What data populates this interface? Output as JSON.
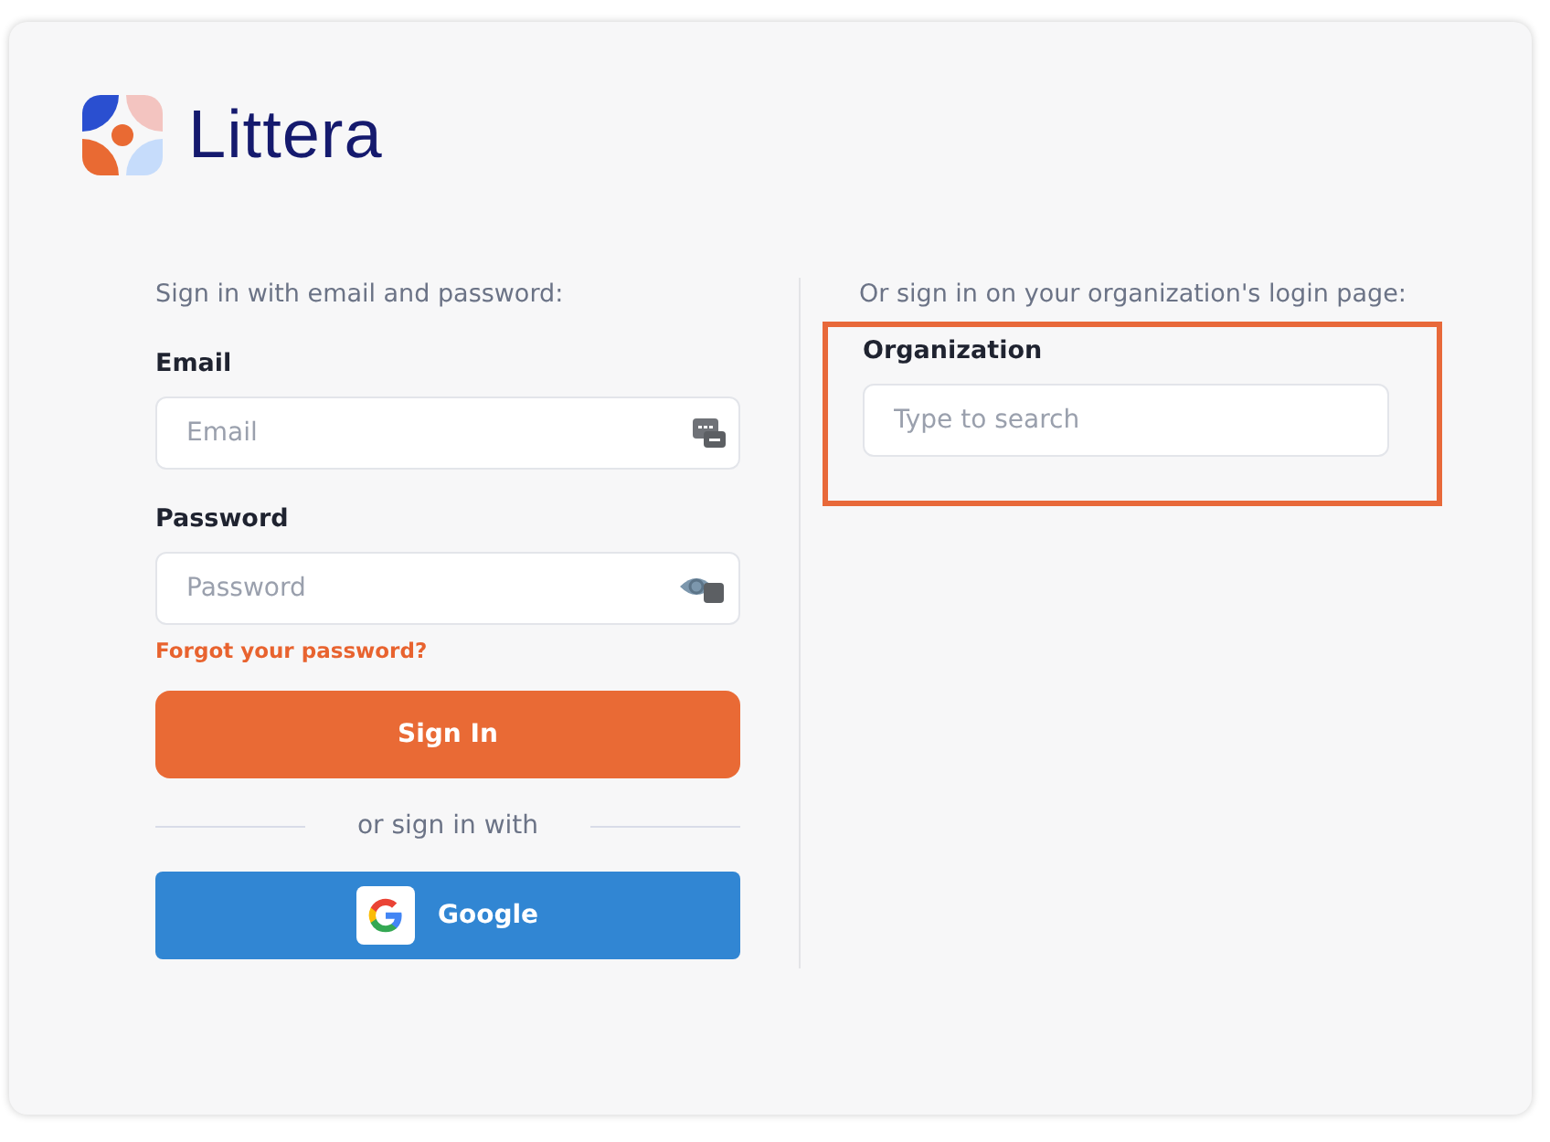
{
  "brand": {
    "name": "Littera"
  },
  "password_signin": {
    "heading": "Sign in with email and password:",
    "email": {
      "label": "Email",
      "placeholder": "Email"
    },
    "password": {
      "label": "Password",
      "placeholder": "Password"
    },
    "forgot_link": "Forgot your password?",
    "submit": "Sign In",
    "divider": "or sign in with",
    "google_button": "Google"
  },
  "organization_signin": {
    "heading": "Or sign in on your organization's login page:",
    "highlighted": true,
    "organization": {
      "label": "Organization",
      "placeholder": "Type to search"
    }
  }
}
